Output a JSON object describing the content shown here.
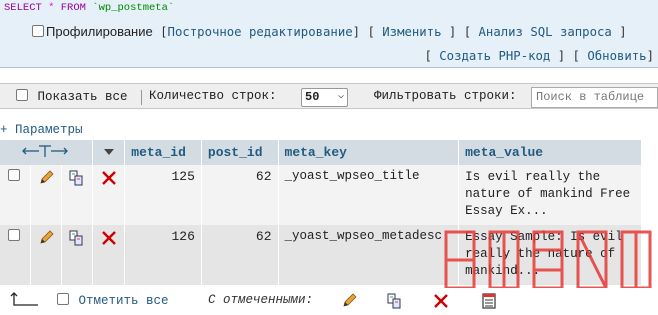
{
  "query": {
    "select_kw": "SELECT",
    "star": "*",
    "from_kw": "FROM",
    "table": "`wp_postmeta`"
  },
  "sql_actions": {
    "profiling_label": "Профилирование",
    "inline_edit": "Построчное редактирование",
    "edit": "Изменить",
    "explain": "Анализ SQL запроса",
    "create_php": "Создать PHP-код",
    "refresh": "Обновить"
  },
  "navigation": {
    "show_all": "Показать все",
    "rows_label": "Количество строк:",
    "rows_value": "50",
    "filter_label": "Фильтровать строки:",
    "search_placeholder": "Поиск в таблице"
  },
  "options_link": "+ Параметры",
  "table": {
    "columns": [
      "meta_id",
      "post_id",
      "meta_key",
      "meta_value"
    ],
    "rows": [
      {
        "meta_id": "125",
        "post_id": "62",
        "meta_key": "_yoast_wpseo_title",
        "meta_value": "Is evil really the nature of mankind Free Essay Ex..."
      },
      {
        "meta_id": "126",
        "post_id": "62",
        "meta_key": "_yoast_wpseo_metadesc",
        "meta_value": "Essay Sample: Is evil really the nature of mankind..."
      }
    ]
  },
  "bulk": {
    "check_all": "Отметить все",
    "with_selected": "С отмеченными:"
  },
  "colors": {
    "link": "#235a81",
    "header_bg": "#d3dce3",
    "sql_bg": "#e5f0f8",
    "delete_red": "#cc0000",
    "watermark_red": "#e53935"
  },
  "icons": [
    "pencil-icon",
    "copy-icon",
    "delete-icon",
    "export-icon",
    "arrow-icon",
    "sort-arrows-icon",
    "chevron-down-icon"
  ]
}
